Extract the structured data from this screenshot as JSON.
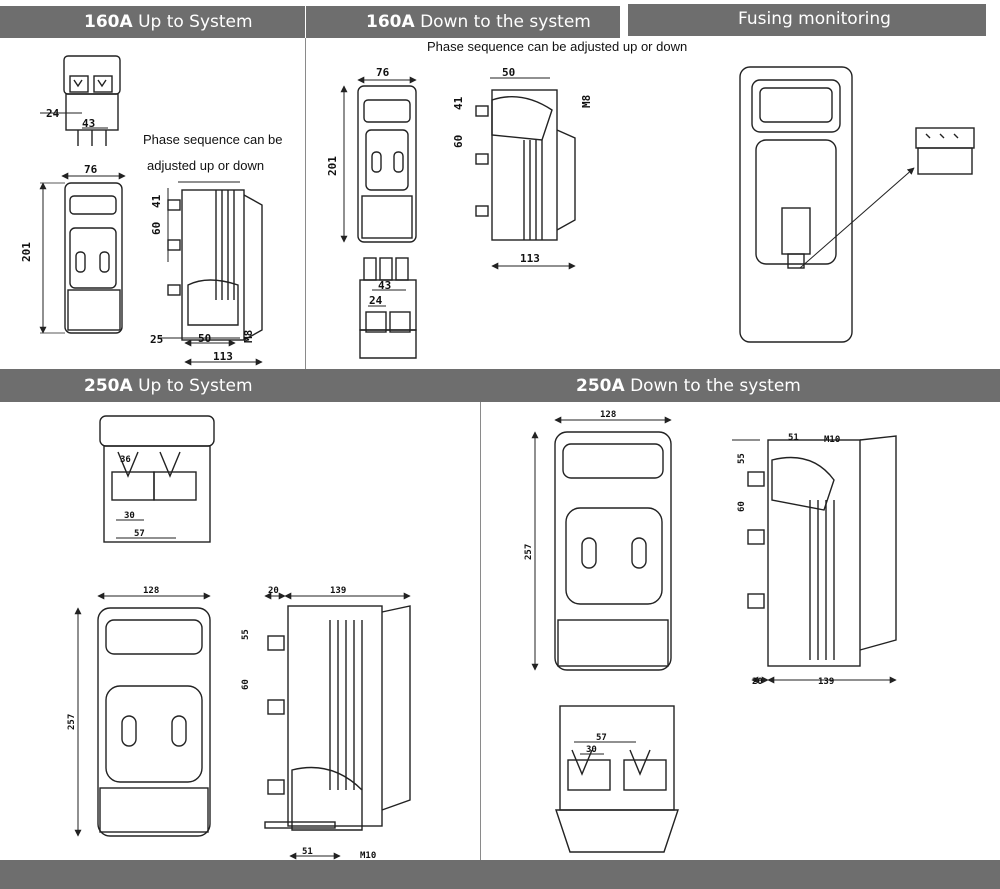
{
  "headers": {
    "h160_up": {
      "amp": "160A",
      "text": "Up to System"
    },
    "h160_down": {
      "amp": "160A",
      "text": "Down to the system"
    },
    "fusing": {
      "text": "Fusing monitoring"
    },
    "h250_up": {
      "amp": "250A",
      "text": "Up to System"
    },
    "h250_down": {
      "amp": "250A",
      "text": "Down to the system"
    }
  },
  "notes": {
    "phase_top": "Phase sequence can be adjusted up or down",
    "phase_left_1": "Phase sequence can be",
    "phase_left_2": "adjusted up or down"
  },
  "dims_160_up": {
    "d24": "24",
    "d43": "43",
    "d76": "76",
    "d201": "201",
    "d41": "41",
    "d60": "60",
    "d25": "25",
    "d50": "50",
    "m8": "M8",
    "d113": "113"
  },
  "dims_160_down": {
    "d76": "76",
    "d201": "201",
    "d50": "50",
    "d41": "41",
    "d60": "60",
    "m8": "M8",
    "d113": "113",
    "d43": "43",
    "d24": "24"
  },
  "dims_250_up": {
    "d36": "36",
    "d30": "30",
    "d57": "57",
    "d128": "128",
    "d257": "257",
    "d20": "20",
    "d139": "139",
    "d55": "55",
    "d60": "60",
    "d51": "51",
    "m10": "M10"
  },
  "dims_250_down": {
    "d128": "128",
    "d257": "257",
    "d51": "51",
    "m10": "M10",
    "d55": "55",
    "d60": "60",
    "d20": "20",
    "d139": "139",
    "d57": "57",
    "d30": "30"
  },
  "colors": {
    "header_bar": "#6e6e6e",
    "line": "#222222",
    "background": "#ffffff"
  }
}
